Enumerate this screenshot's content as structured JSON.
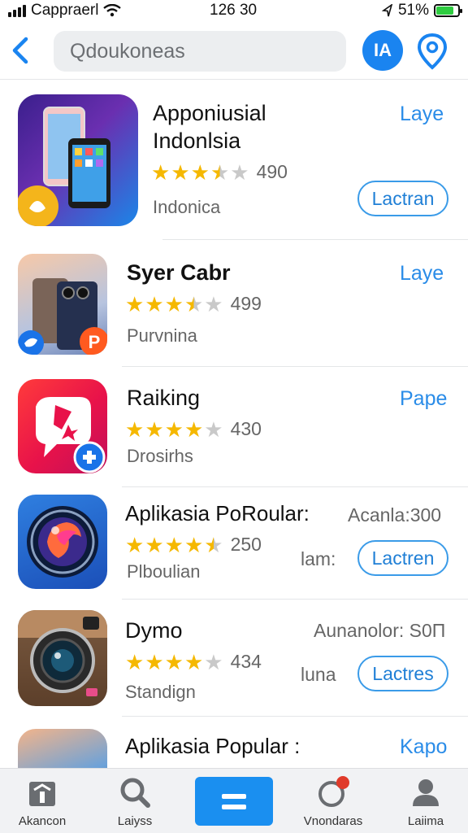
{
  "status_bar": {
    "carrier": "Capprаerl",
    "time": "126 30",
    "battery": "51%",
    "colors": {
      "battery_fill": "#2ecc40"
    }
  },
  "header": {
    "search_placeholder": "Qdoukoneas",
    "avatar_label": "IA"
  },
  "apps": [
    {
      "name_line1": "Apponiusial",
      "name_line2": "Indonlsia",
      "rating": 3.5,
      "rating_count": "490",
      "subtitle": "Indonica",
      "action_link": "Laye",
      "button": "Lactran"
    },
    {
      "name": "Syer Cabr",
      "rating": 3.5,
      "rating_count": "499",
      "subtitle": "Purvnina",
      "action_link": "Laye"
    },
    {
      "name": "Raiking",
      "rating": 4,
      "rating_count": "430",
      "subtitle": "Drosirhs",
      "action_link": "Pape"
    },
    {
      "name": "Aplikasia PoRoular:",
      "rating": 4.5,
      "rating_count": "250",
      "subtitle": "Plboulian",
      "meta_top": "Acanla:300",
      "meta_mid": "lam:",
      "button": "Lactren"
    },
    {
      "name": "Dymo",
      "rating": 4,
      "rating_count": "434",
      "subtitle": "Standign",
      "meta_top": "Aunanolor: S0П",
      "meta_mid": "luna",
      "button": "Lactres"
    },
    {
      "name": "Aplikasia Popular :",
      "action_link": "Kapo"
    }
  ],
  "tabbar": {
    "tabs": [
      {
        "label": "Akancon",
        "icon": "home-icon"
      },
      {
        "label": "Laiyss",
        "icon": "search-icon"
      },
      {
        "label": "",
        "icon": "menu-icon"
      },
      {
        "label": "Vnondaras",
        "icon": "refresh-icon",
        "badge": "1"
      },
      {
        "label": "Laiima",
        "icon": "person-icon"
      }
    ],
    "colors": {
      "accent": "#1a8ff0"
    }
  }
}
